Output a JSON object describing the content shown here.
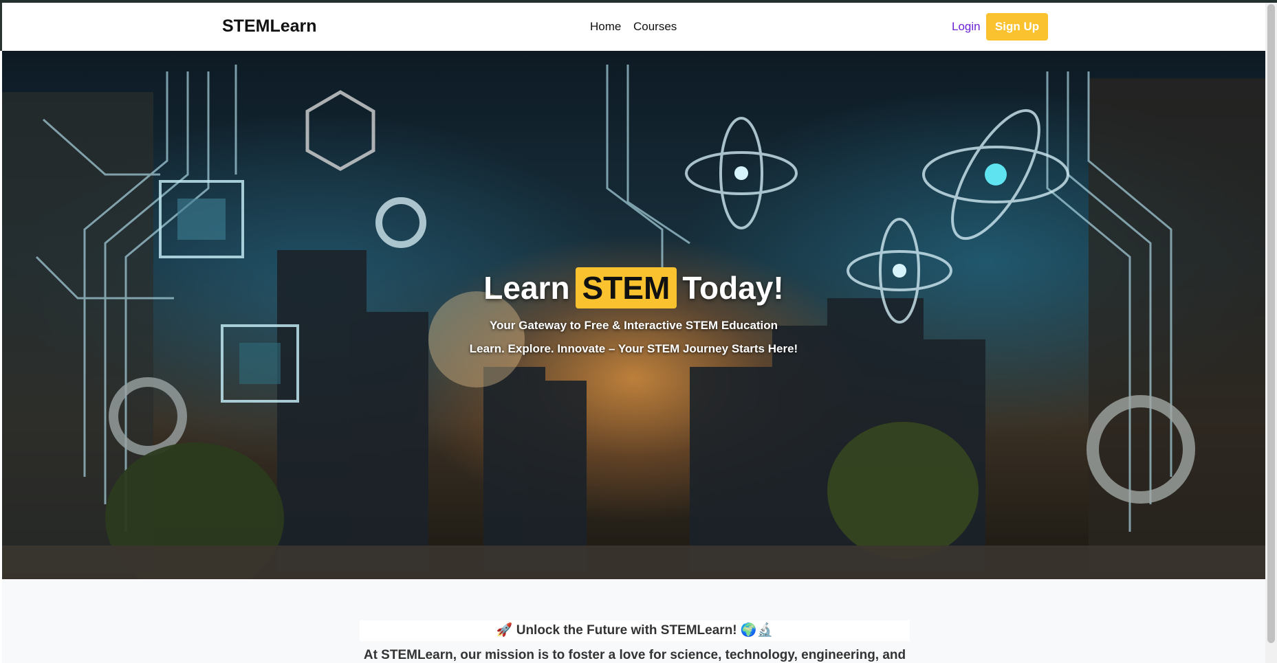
{
  "nav": {
    "brand": "STEMLearn",
    "links": [
      "Home",
      "Courses"
    ],
    "login_label": "Login",
    "signup_label": "Sign Up"
  },
  "hero": {
    "title_before": "Learn",
    "title_highlight": "STEM",
    "title_after": "Today!",
    "subtitle": "Your Gateway to Free & Interactive STEM Education",
    "tagline": "Learn. Explore. Innovate – Your STEM Journey Starts Here!"
  },
  "intro": {
    "heading": "🚀 Unlock the Future with STEMLearn! 🌍🔬",
    "mission_text": "At STEMLearn, our mission is to foster a love for science, technology, engineering, and"
  },
  "colors": {
    "accent": "#f9c22e",
    "login_link": "#6b21d6"
  }
}
